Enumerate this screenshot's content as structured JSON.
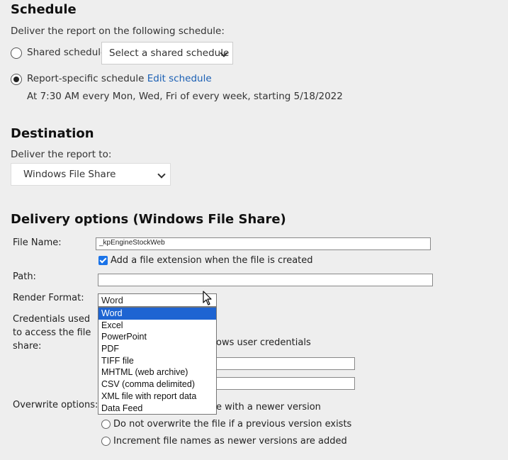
{
  "schedule": {
    "heading": "Schedule",
    "intro": "Deliver the report on the following schedule:",
    "shared_label": "Shared schedule",
    "shared_select_value": "Select a shared schedule",
    "report_specific_label": "Report-specific schedule",
    "edit_link": "Edit schedule",
    "summary": "At 7:30 AM every Mon, Wed, Fri of every week, starting 5/18/2022"
  },
  "destination": {
    "heading": "Destination",
    "intro": "Deliver the report to:",
    "select_value": "Windows File Share"
  },
  "delivery": {
    "heading": "Delivery options (Windows File Share)",
    "file_name_label": "File Name:",
    "file_name_value": "_kpEngineStockWeb",
    "add_extension_label": "Add a file extension when the file is created",
    "path_label": "Path:",
    "path_value": "",
    "render_format_label": "Render Format:",
    "render_format_value": "Word",
    "render_format_options": [
      "Word",
      "Excel",
      "PowerPoint",
      "PDF",
      "TIFF file",
      "MHTML (web archive)",
      "CSV (comma delimited)",
      "XML file with report data",
      "Data Feed"
    ],
    "credentials_label_1": "Credentials used",
    "credentials_label_2": "to access the file",
    "credentials_label_3": "share:",
    "credentials_option_partial": "ows user credentials",
    "overwrite_label": "Overwrite options:",
    "overwrite_opt1_partial": "e with a newer version",
    "overwrite_opt2": "Do not overwrite the file if a previous version exists",
    "overwrite_opt3": "Increment file names as newer versions are added"
  }
}
